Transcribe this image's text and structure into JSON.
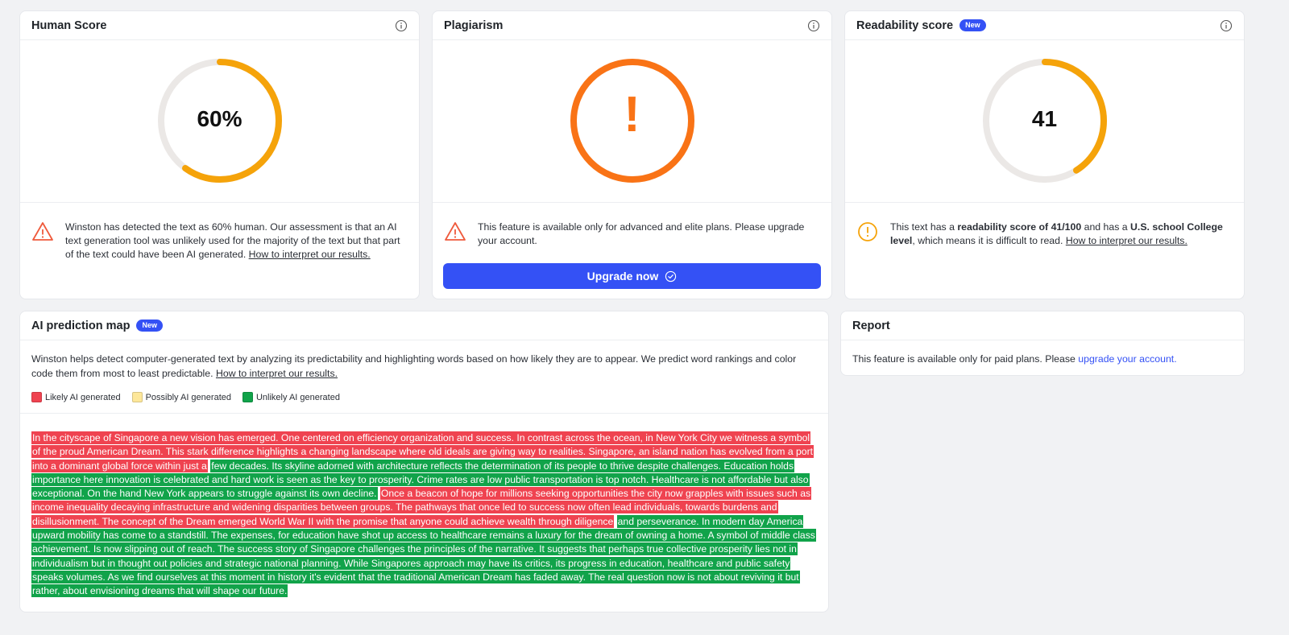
{
  "colors": {
    "accent": "#3451f5",
    "orange": "#f5a30a",
    "plagiarism": "#f97316",
    "likely_ai": "#ef4350",
    "possibly_ai": "#fde79a",
    "unlikely_ai": "#11a34a"
  },
  "human_score": {
    "title": "Human Score",
    "value": "60%",
    "fraction": 0.6,
    "message": "Winston has detected the text as 60% human. Our assessment is that an AI text generation tool was unlikely used for the majority of the text but that part of the text could have been AI generated.",
    "link": "How to interpret our results."
  },
  "plagiarism": {
    "title": "Plagiarism",
    "symbol": "!",
    "message": "This feature is available only for advanced and elite plans. Please upgrade your account.",
    "button_label": "Upgrade now"
  },
  "readability": {
    "title": "Readability score",
    "badge": "New",
    "value": "41",
    "fraction": 0.41,
    "msg_pre": "This text has a ",
    "msg_bold1": "readability score of 41/100",
    "msg_mid": " and has a ",
    "msg_bold2": "U.S. school College level",
    "msg_post": ", which means it is difficult to read. ",
    "link": "How to interpret our results."
  },
  "prediction_map": {
    "title": "AI prediction map",
    "badge": "New",
    "description": "Winston helps detect computer-generated text by analyzing its predictability and highlighting words based on how likely they are to appear. We predict word rankings and color code them from most to least predictable.",
    "link": "How to interpret our results.",
    "legend": [
      "Likely AI generated",
      "Possibly AI generated",
      "Unlikely AI generated"
    ],
    "segments": [
      {
        "kind": "ai",
        "text": "In the cityscape of Singapore a new vision has emerged. One centered on efficiency organization and success. In contrast across the ocean, in New York City we witness a symbol of the proud American Dream. This stark difference highlights a changing landscape where old ideals are giving way to realities. Singapore, an island nation has evolved from a port into a dominant global force within just a"
      },
      {
        "kind": "human",
        "text": "few decades. Its skyline adorned with architecture reflects the determination of its people to thrive despite challenges. Education holds importance here innovation is celebrated and hard work is seen as the key to prosperity. Crime rates are low public transportation is top notch. Healthcare is not affordable but also exceptional. On the hand New York appears to struggle against its own decline."
      },
      {
        "kind": "ai",
        "text": "Once a beacon of hope for millions seeking opportunities the city now grapples with issues such as income inequality decaying infrastructure and widening disparities between groups. The pathways that once led to success now often lead individuals, towards burdens and disillusionment. The concept of the Dream emerged World War II with the promise that anyone could achieve wealth through diligence"
      },
      {
        "kind": "human",
        "text": "and perseverance. In modern day America upward mobility has come to a standstill. The expenses, for education have shot up access to healthcare remains a luxury for the dream of owning a home. A symbol of middle class achievement. Is now slipping out of reach. The success story of Singapore challenges the principles of the narrative. It suggests that perhaps true collective prosperity lies not in individualism but in thought out policies and strategic national planning. While Singapores approach may have its critics, its progress in education, healthcare and public safety speaks volumes. As we find ourselves at this moment in history it's evident that the traditional American Dream has faded away. The real question now is not about reviving it but rather, about envisioning dreams that will shape our future."
      }
    ]
  },
  "report": {
    "title": "Report",
    "message": "This feature is available only for paid plans. Please ",
    "link": "upgrade your account."
  }
}
